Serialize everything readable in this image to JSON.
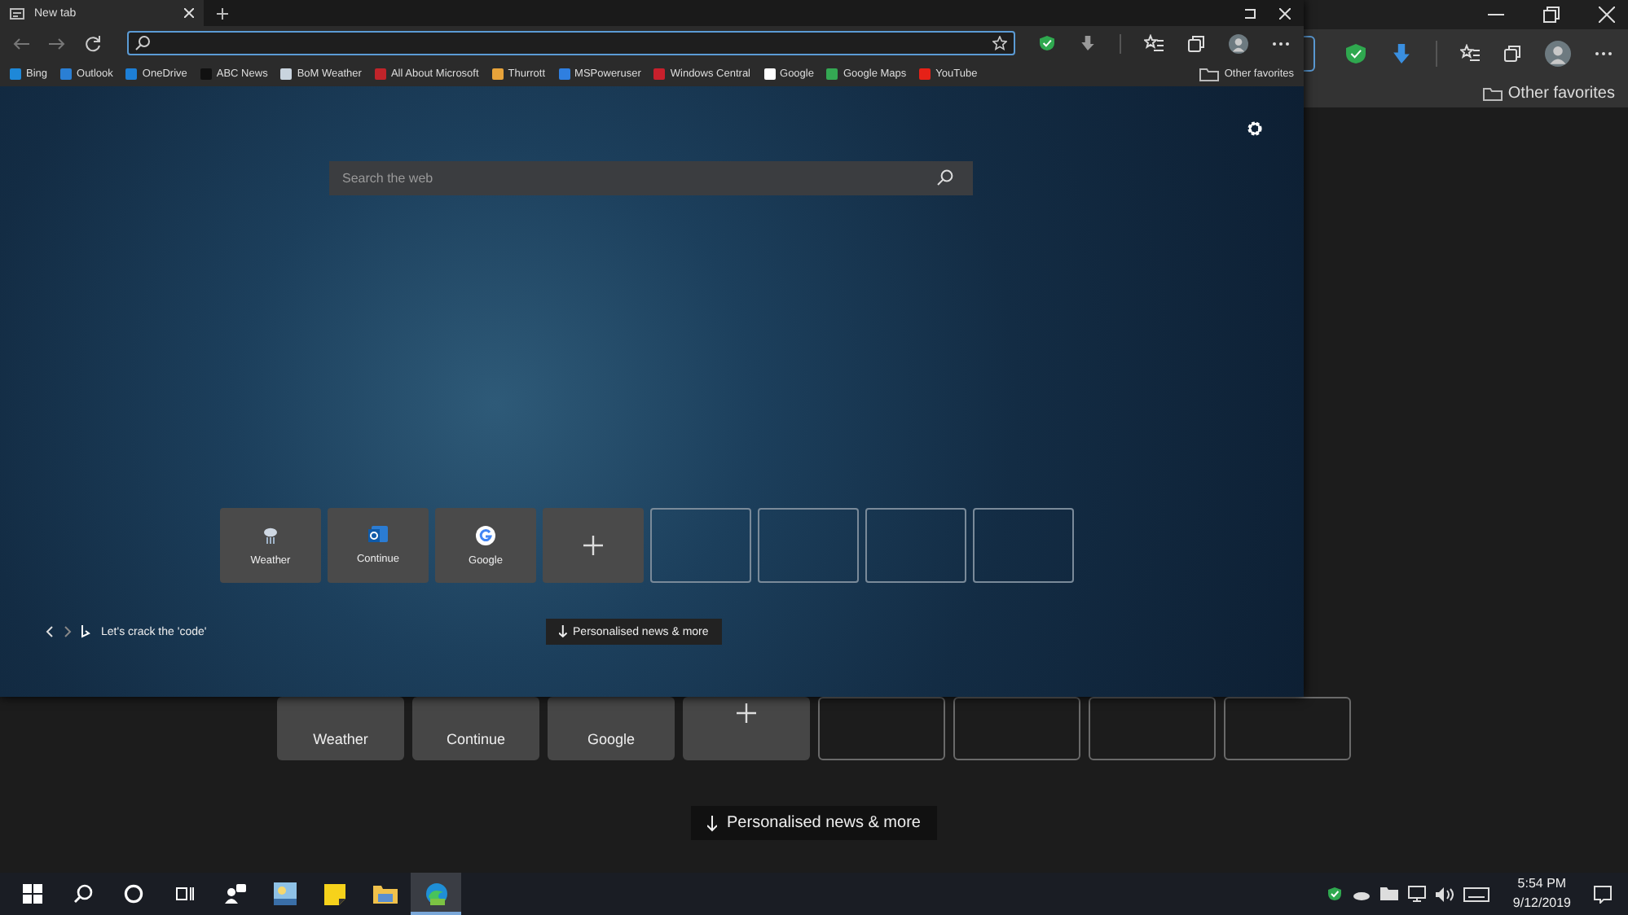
{
  "back_window": {
    "other_favorites": "Other favorites",
    "top_sites": [
      {
        "kind": "site",
        "label": "Weather"
      },
      {
        "kind": "site",
        "label": "Continue"
      },
      {
        "kind": "site",
        "label": "Google"
      },
      {
        "kind": "add"
      },
      {
        "kind": "empty"
      },
      {
        "kind": "empty"
      },
      {
        "kind": "empty"
      },
      {
        "kind": "empty"
      }
    ],
    "news_button": "Personalised news & more"
  },
  "front_window": {
    "tabs": [
      {
        "label": "New tab",
        "selected": true
      }
    ],
    "favorites": [
      {
        "label": "Bing",
        "color": "#1e88d8"
      },
      {
        "label": "Outlook",
        "color": "#2a7fd4"
      },
      {
        "label": "OneDrive",
        "color": "#1d7fd6"
      },
      {
        "label": "ABC News",
        "color": "#111111"
      },
      {
        "label": "BoM Weather",
        "color": "#c9d4de"
      },
      {
        "label": "All About Microsoft",
        "color": "#c0242a"
      },
      {
        "label": "Thurrott",
        "color": "#e8a33a"
      },
      {
        "label": "MSPoweruser",
        "color": "#2f7fe0"
      },
      {
        "label": "Windows Central",
        "color": "#c8202c"
      },
      {
        "label": "Google",
        "color": "#ffffff"
      },
      {
        "label": "Google Maps",
        "color": "#34a853"
      },
      {
        "label": "YouTube",
        "color": "#e62117"
      }
    ],
    "other_favorites": "Other favorites",
    "search": {
      "placeholder": "Search the web"
    },
    "top_sites": [
      {
        "kind": "weather",
        "label": "Weather"
      },
      {
        "kind": "mail",
        "label": "Continue"
      },
      {
        "kind": "google",
        "label": "Google"
      },
      {
        "kind": "add"
      },
      {
        "kind": "empty"
      },
      {
        "kind": "empty"
      },
      {
        "kind": "empty"
      },
      {
        "kind": "empty"
      }
    ],
    "caption": "Let's crack the 'code'",
    "news_button": "Personalised news & more"
  },
  "taskbar": {
    "apps": [
      {
        "kind": "start",
        "selected": false
      },
      {
        "kind": "search",
        "selected": false
      },
      {
        "kind": "cortana",
        "selected": false
      },
      {
        "kind": "taskview",
        "selected": false
      },
      {
        "kind": "people",
        "selected": false
      },
      {
        "kind": "weather",
        "selected": false
      },
      {
        "kind": "notes",
        "selected": false
      },
      {
        "kind": "explorer",
        "selected": false
      },
      {
        "kind": "edge",
        "selected": true
      }
    ],
    "clock": {
      "time": "5:54 PM",
      "date": "9/12/2019"
    }
  }
}
